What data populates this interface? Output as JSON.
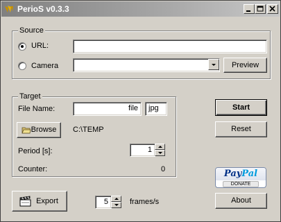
{
  "window": {
    "title": "PerioS v0.3.3",
    "controls": [
      "minimize",
      "maximize",
      "close"
    ]
  },
  "source": {
    "group_label": "Source",
    "url_label": "URL:",
    "url_value": "",
    "url_selected": true,
    "camera_label": "Camera",
    "camera_value": "",
    "preview_button": "Preview"
  },
  "target": {
    "group_label": "Target",
    "file_name_label": "File Name:",
    "file_name_value": "file",
    "file_ext_value": "jpg",
    "browse_button": "Browse",
    "directory": "C:\\TEMP",
    "period_label": "Period [s]:",
    "period_value": "1",
    "counter_label": "Counter:",
    "counter_value": "0"
  },
  "actions": {
    "start_button": "Start",
    "reset_button": "Reset",
    "about_button": "About"
  },
  "paypal": {
    "logo_part1": "Pay",
    "logo_part2": "Pal",
    "donate": "DONATE"
  },
  "export": {
    "export_button": "Export",
    "fps_value": "5",
    "fps_label": "frames/s"
  },
  "icons": {
    "app": "app-icon",
    "browse": "folder-icon",
    "export": "clapperboard-icon",
    "dropdown": "chevron-down-icon"
  }
}
